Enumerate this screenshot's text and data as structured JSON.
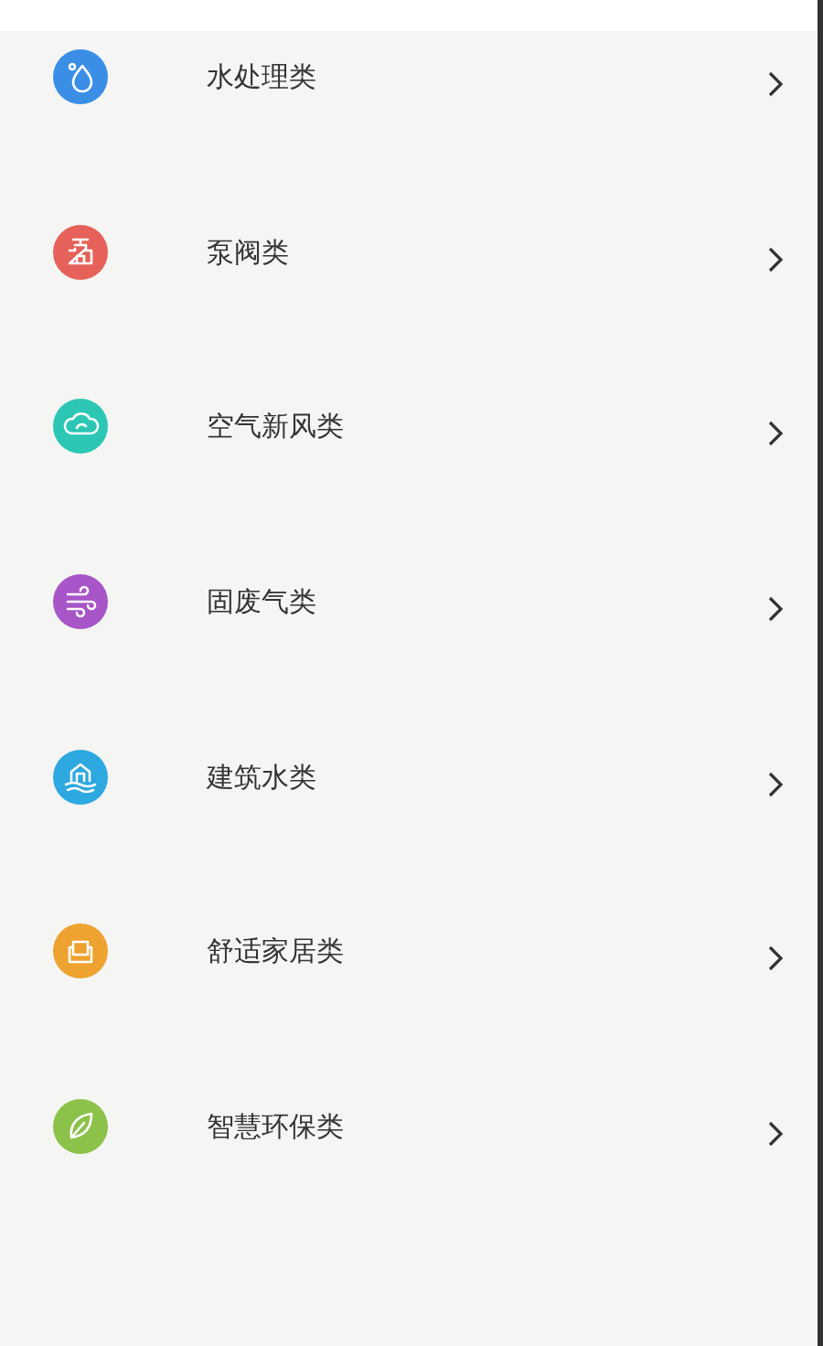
{
  "categories": [
    {
      "label": "水处理类",
      "kind": "drop",
      "color": "#3a8ee6"
    },
    {
      "label": "泵阀类",
      "kind": "valve",
      "color": "#e5615a"
    },
    {
      "label": "空气新风类",
      "kind": "cloud",
      "color": "#2cc7b4"
    },
    {
      "label": "固废气类",
      "kind": "wind",
      "color": "#a855c8"
    },
    {
      "label": "建筑水类",
      "kind": "house",
      "color": "#2ea8e0"
    },
    {
      "label": "舒适家居类",
      "kind": "sofa",
      "color": "#eea22f"
    },
    {
      "label": "智慧环保类",
      "kind": "leaf",
      "color": "#8cc24a"
    }
  ]
}
